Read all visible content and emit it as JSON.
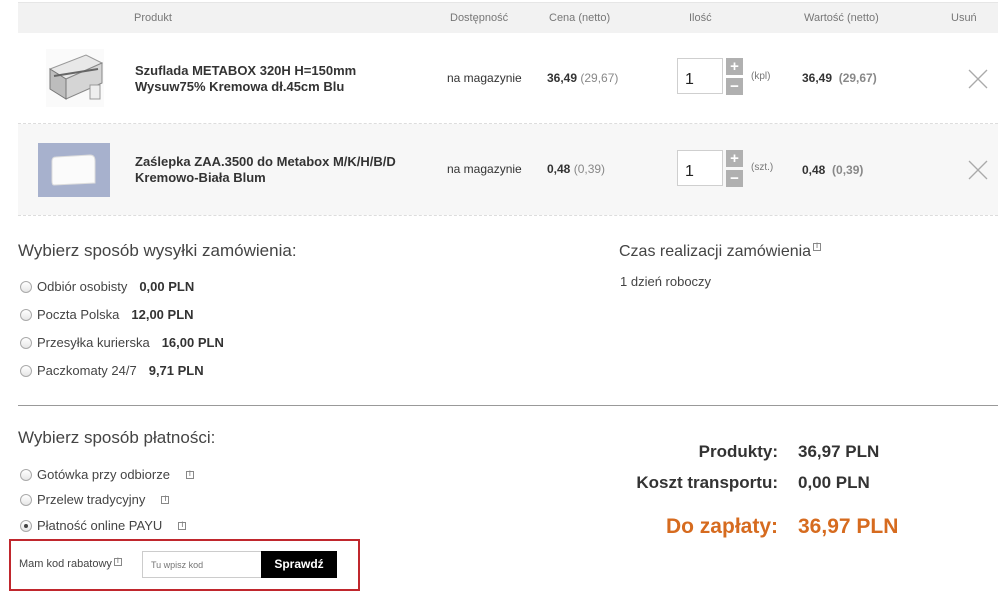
{
  "table": {
    "headers": {
      "product": "Produkt",
      "availability": "Dostępność",
      "price": "Cena (netto)",
      "quantity": "Ilość",
      "value": "Wartość (netto)",
      "remove": "Usuń"
    }
  },
  "items": [
    {
      "name_line1": "Szuflada METABOX 320H H=150mm",
      "name_line2": "Wysuw75% Kremowa dł.45cm Blu",
      "availability": "na magazynie",
      "price_gross": "36,49",
      "price_net": "(29,67)",
      "quantity": "1",
      "unit": "(kpl)",
      "value_gross": "36,49",
      "value_net": "(29,67)",
      "image_icon": "drawer-image-icon"
    },
    {
      "name_line1": "Zaślepka ZAA.3500 do Metabox M/K/H/B/D",
      "name_line2": "Kremowo-Biała Blum",
      "availability": "na magazynie",
      "price_gross": "0,48",
      "price_net": "(0,39)",
      "quantity": "1",
      "unit": "(szt.)",
      "value_gross": "0,48",
      "value_net": "(0,39)",
      "image_icon": "end-cap-image-icon"
    }
  ],
  "stepper": {
    "plus": "+",
    "minus": "−"
  },
  "shipping": {
    "title": "Wybierz sposób wysyłki zamówienia:",
    "options": [
      {
        "label": "Odbiór osobisty",
        "cost": "0,00 PLN",
        "selected": false
      },
      {
        "label": "Poczta Polska",
        "cost": "12,00 PLN",
        "selected": false
      },
      {
        "label": "Przesyłka kurierska",
        "cost": "16,00 PLN",
        "selected": false
      },
      {
        "label": "Paczkomaty 24/7",
        "cost": "9,71 PLN",
        "selected": false
      }
    ]
  },
  "lead_time": {
    "title": "Czas realizacji zamówienia",
    "value": "1 dzień roboczy"
  },
  "payment": {
    "title": "Wybierz sposób płatności:",
    "options": [
      {
        "label": "Gotówka przy odbiorze",
        "selected": false
      },
      {
        "label": "Przelew tradycyjny",
        "selected": false
      },
      {
        "label": "Płatność online PAYU",
        "selected": true
      }
    ]
  },
  "info_glyph": "i",
  "summary": {
    "products_label": "Produkty:",
    "products_value": "36,97 PLN",
    "transport_label": "Koszt transportu:",
    "transport_value": "0,00 PLN",
    "due_label": "Do zapłaty:",
    "due_value": "36,97 PLN",
    "due_color": "#d66b1f"
  },
  "coupon": {
    "label": "Mam kod rabatowy",
    "placeholder": "Tu wpisz kod",
    "button": "Sprawdź",
    "highlight_color": "#c0272d"
  }
}
